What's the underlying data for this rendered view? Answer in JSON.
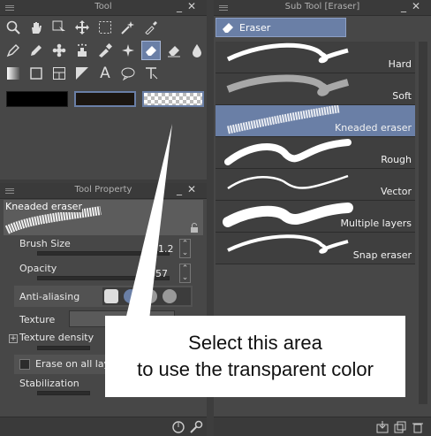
{
  "tool_panel": {
    "title": "Tool",
    "tools": [
      {
        "name": "zoom-icon",
        "glyph": "🔍"
      },
      {
        "name": "hand-icon",
        "glyph": "✋"
      },
      {
        "name": "object-select-icon",
        "glyph": "⬚"
      },
      {
        "name": "move-icon",
        "glyph": "✥"
      },
      {
        "name": "selection-icon",
        "glyph": "⬚"
      },
      {
        "name": "auto-select-icon",
        "glyph": "✴"
      },
      {
        "name": "eyedropper-icon",
        "glyph": "✎"
      },
      {
        "name": "pen-icon",
        "glyph": "✒"
      },
      {
        "name": "pencil-icon",
        "glyph": "✏"
      },
      {
        "name": "brush-icon",
        "glyph": "✿"
      },
      {
        "name": "airbrush-icon",
        "glyph": "⛽"
      },
      {
        "name": "decoration-icon",
        "glyph": "✐"
      },
      {
        "name": "effect-icon",
        "glyph": "✦"
      },
      {
        "name": "eraser-icon",
        "glyph": "◆"
      },
      {
        "name": "blend-icon",
        "glyph": "◈"
      },
      {
        "name": "fill-icon",
        "glyph": "💧"
      },
      {
        "name": "gradient-icon",
        "glyph": "◐"
      },
      {
        "name": "figure-icon",
        "glyph": "▭"
      },
      {
        "name": "frame-icon",
        "glyph": "▣"
      },
      {
        "name": "ruler-icon",
        "glyph": "◸"
      },
      {
        "name": "text-icon",
        "glyph": "A"
      },
      {
        "name": "balloon-icon",
        "glyph": "💬"
      },
      {
        "name": "correct-line-icon",
        "glyph": "⮣"
      }
    ],
    "colors": {
      "main": "#000000",
      "sub": "#1b1611",
      "transparent_label": "transparent"
    }
  },
  "property_panel": {
    "title": "Tool Property",
    "preview_label": "Kneaded eraser",
    "brush_size_label": "Brush Size",
    "brush_size_value": "71.2",
    "opacity_label": "Opacity",
    "opacity_value": "57",
    "anti_aliasing_label": "Anti-aliasing",
    "texture_label": "Texture",
    "texture_density_label": "Texture density",
    "erase_on_all_label": "Erase on all lay",
    "stabilization_label": "Stabilization"
  },
  "sub_panel": {
    "title": "Sub Tool [Eraser]",
    "tab_label": "Eraser",
    "items": [
      {
        "label": "Hard"
      },
      {
        "label": "Soft"
      },
      {
        "label": "Kneaded eraser"
      },
      {
        "label": "Rough"
      },
      {
        "label": "Vector"
      },
      {
        "label": "Multiple layers"
      },
      {
        "label": "Snap eraser"
      }
    ]
  },
  "callout": {
    "line1": "Select this area",
    "line2": "to use the transparent color"
  },
  "accent_color": "#6a7fa6"
}
